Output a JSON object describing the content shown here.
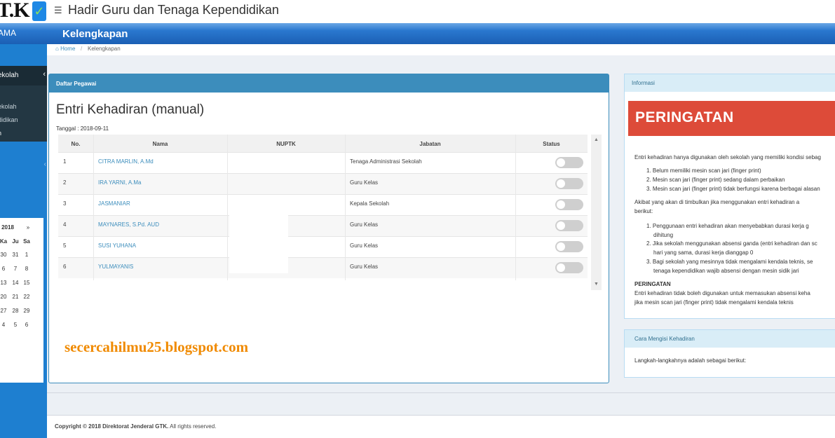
{
  "header": {
    "logo_text": "T.K",
    "menu_icon": "hamburger-icon",
    "app_title": "Hadir Guru dan Tenaga Kependidikan"
  },
  "band": {
    "left_label": "AMA",
    "page_title": "Kelengkapan"
  },
  "breadcrumb": {
    "home": "Home",
    "separator": "/",
    "current": "Kelengkapan"
  },
  "sidebar": {
    "active_item": "ekolah",
    "sub_items": [
      "ekolah",
      "didikan",
      "n"
    ]
  },
  "calendar": {
    "year": "2018",
    "next": "»",
    "weekdays": [
      "Ka",
      "Ju",
      "Sa"
    ],
    "rows": [
      [
        "30",
        "31",
        "1"
      ],
      [
        "6",
        "7",
        "8"
      ],
      [
        "13",
        "14",
        "15"
      ],
      [
        "20",
        "21",
        "22"
      ],
      [
        "27",
        "28",
        "29"
      ],
      [
        "4",
        "5",
        "6"
      ]
    ]
  },
  "panel": {
    "header": "Daftar Pegawai",
    "title": "Entri Kehadiran (manual)",
    "date_label": "Tanggal : 2018-09-11",
    "columns": [
      "No.",
      "Nama",
      "NUPTK",
      "Jabatan",
      "Status"
    ],
    "rows": [
      {
        "no": "1",
        "nama": "CITRA MARLIN, A.Md",
        "nuptk": "",
        "jabatan": "Tenaga Administrasi Sekolah",
        "status": false
      },
      {
        "no": "2",
        "nama": "IRA YARNI, A.Ma",
        "nuptk": "",
        "jabatan": "Guru Kelas",
        "status": false
      },
      {
        "no": "3",
        "nama": "JASMANIAR",
        "nuptk": "",
        "jabatan": "Kepala Sekolah",
        "status": false
      },
      {
        "no": "4",
        "nama": "MAYNARES, S.Pd. AUD",
        "nuptk": "",
        "jabatan": "Guru Kelas",
        "status": false
      },
      {
        "no": "5",
        "nama": "SUSI YUHANA",
        "nuptk": "",
        "jabatan": "Guru Kelas",
        "status": false
      },
      {
        "no": "6",
        "nama": "YULMAYANIS",
        "nuptk": "",
        "jabatan": "Guru Kelas",
        "status": false
      }
    ]
  },
  "watermark": "secercahilmu25.blogspot.com",
  "info": {
    "header": "Informasi",
    "banner": "PERINGATAN",
    "intro": "Entri kehadiran hanya digunakan oleh sekolah yang memiliki kondisi sebag",
    "conditions": [
      "1. Belum memiliki mesin scan jari (finger print)",
      "2. Mesin scan jari (finger print) sedang dalam perbaikan",
      "3. Mesin scan jari (finger print) tidak berfungsi karena berbagai alasan"
    ],
    "akibat_line1": "Akibat  yang  akan  di  timbulkan  jika  menggunakan  entri  kehadiran  a",
    "akibat_line2": "berikut:",
    "consequences": [
      [
        "1. Penggunaan  entri  kehadiran  akan  menyebabkan  durasi  kerja  g",
        "dihitung"
      ],
      [
        "2. Jika sekolah menggunakan absensi ganda (entri kehadiran dan sc",
        "hari yang sama, durasi kerja dianggap 0"
      ],
      [
        "3. Bagi  sekolah  yang  mesinnya  tidak  mengalami  kendala  teknis,  se",
        "tenaga kependidikan wajib absensi dengan mesin sidik jari"
      ]
    ],
    "warning_title": "PERINGATAN",
    "warning_line1": "Entri kehadiran tidak boleh digunakan untuk memasukan absensi keha",
    "warning_line2": "jika mesin scan jari (finger print) tidak mengalami kendala teknis"
  },
  "howto": {
    "header": "Cara Mengisi Kehadiran",
    "text": "Langkah-langkahnya adalah sebagai berikut:"
  },
  "footer": {
    "prefix": "Copyright © 2018 Direktorat Jenderal GTK.",
    "suffix": " All rights reserved."
  }
}
